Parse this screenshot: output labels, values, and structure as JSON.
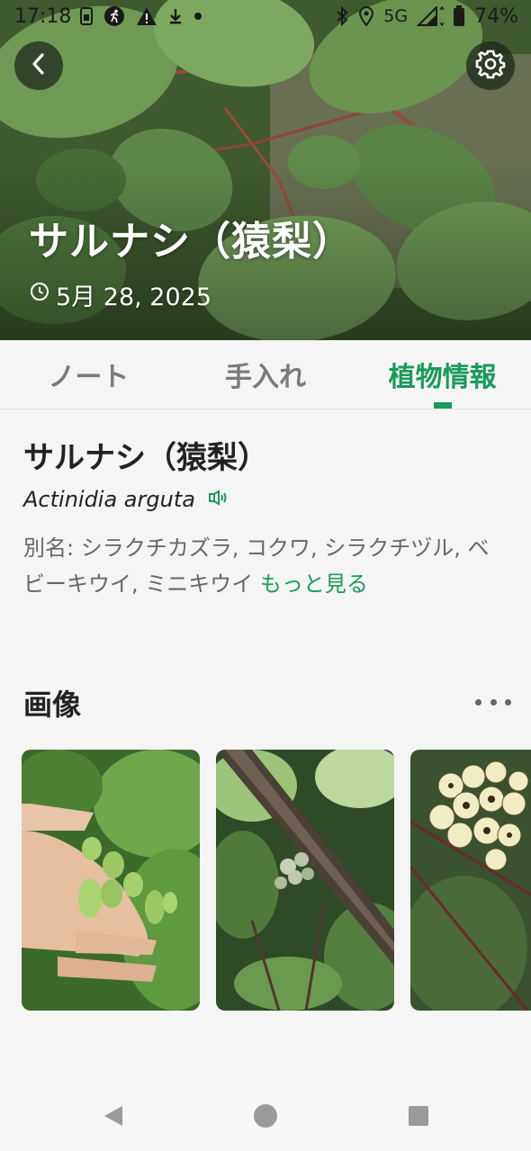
{
  "status_bar": {
    "time": "17:18",
    "network": "5G",
    "battery": "74%",
    "icons": [
      "sim-icon",
      "running-icon",
      "warning-icon",
      "download-icon",
      "dot-icon",
      "bluetooth-icon",
      "location-icon",
      "signal-icon",
      "battery-icon"
    ]
  },
  "header": {
    "title": "サルナシ（猿梨）",
    "date": "5月 28, 2025",
    "back_icon": "chevron-left-icon",
    "settings_icon": "gear-icon"
  },
  "tabs": [
    {
      "label": "ノート",
      "active": false
    },
    {
      "label": "手入れ",
      "active": false
    },
    {
      "label": "植物情報",
      "active": true
    }
  ],
  "plant_info": {
    "name": "サルナシ（猿梨）",
    "scientific_name": "Actinidia arguta",
    "alias_text": "別名: シラクチカズラ, コクワ, シラクチヅル, ベビーキウイ, ミニキウイ",
    "more_label": "もっと見る"
  },
  "images_section": {
    "title": "画像",
    "more_icon": "more-horizontal-icon",
    "images": [
      {
        "subject": "hand-holding-kiwi-berries"
      },
      {
        "subject": "flower-buds-on-vine"
      },
      {
        "subject": "white-flowers"
      }
    ]
  },
  "colors": {
    "accent": "#1a9a5a",
    "tab_inactive": "#7a7a7a",
    "content_bg": "#f5f5f5"
  }
}
